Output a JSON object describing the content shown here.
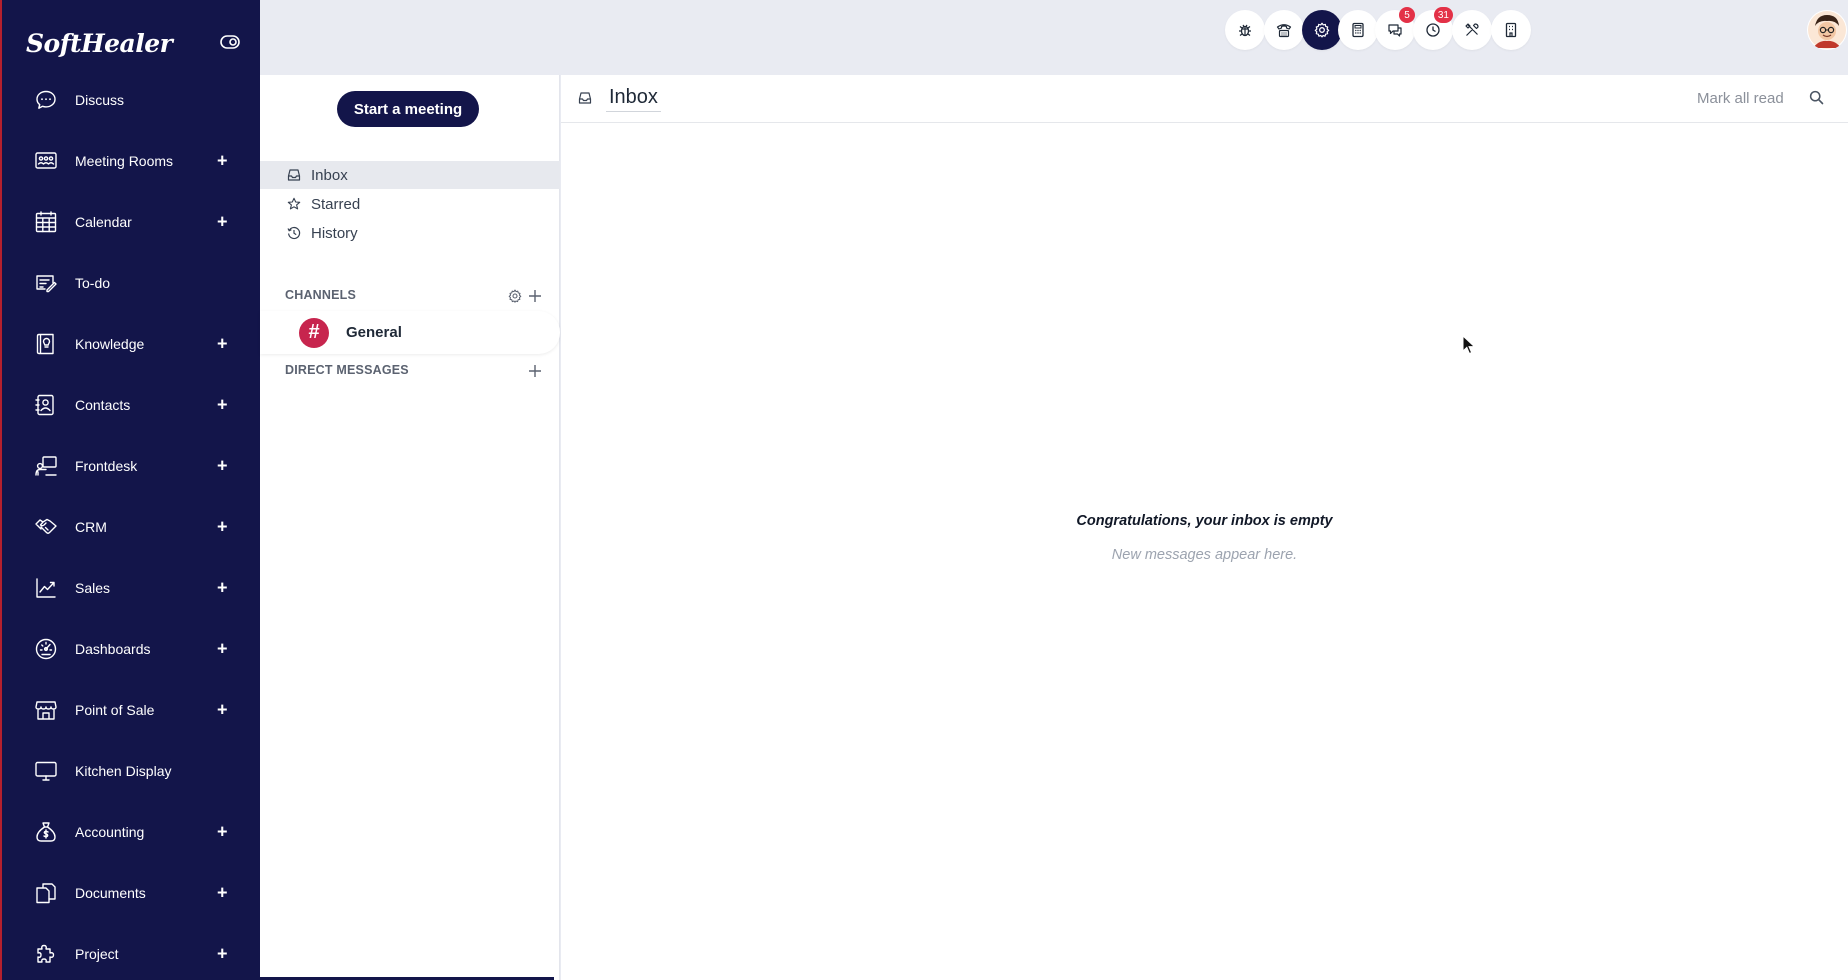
{
  "brand": {
    "name": "SoftHealer"
  },
  "colors": {
    "sidebar_bg": "#13154a",
    "accent_red": "#e33147",
    "channel_avatar": "#c7254e",
    "page_bg": "#e9ebf2"
  },
  "sidebar": {
    "items": [
      {
        "label": "Discuss",
        "icon": "chat-icon",
        "expandable": false
      },
      {
        "label": "Meeting Rooms",
        "icon": "meeting-room-icon",
        "expandable": true
      },
      {
        "label": "Calendar",
        "icon": "calendar-icon",
        "expandable": true
      },
      {
        "label": "To-do",
        "icon": "todo-icon",
        "expandable": false
      },
      {
        "label": "Knowledge",
        "icon": "knowledge-icon",
        "expandable": true
      },
      {
        "label": "Contacts",
        "icon": "contacts-icon",
        "expandable": true
      },
      {
        "label": "Frontdesk",
        "icon": "frontdesk-icon",
        "expandable": true
      },
      {
        "label": "CRM",
        "icon": "handshake-icon",
        "expandable": true
      },
      {
        "label": "Sales",
        "icon": "chart-line-icon",
        "expandable": true
      },
      {
        "label": "Dashboards",
        "icon": "gauge-icon",
        "expandable": true
      },
      {
        "label": "Point of Sale",
        "icon": "store-icon",
        "expandable": true
      },
      {
        "label": "Kitchen Display",
        "icon": "monitor-icon",
        "expandable": false
      },
      {
        "label": "Accounting",
        "icon": "money-bag-icon",
        "expandable": true
      },
      {
        "label": "Documents",
        "icon": "documents-icon",
        "expandable": true
      },
      {
        "label": "Project",
        "icon": "puzzle-icon",
        "expandable": true
      }
    ],
    "plus_symbol": "+"
  },
  "topbar": {
    "buttons": [
      {
        "icon": "bug-icon"
      },
      {
        "icon": "phone-icon"
      },
      {
        "icon": "gear-icon",
        "active": true
      },
      {
        "icon": "calculator-icon"
      },
      {
        "icon": "messages-icon",
        "badge": "5"
      },
      {
        "icon": "activity-clock-icon",
        "badge": "31"
      },
      {
        "icon": "tools-icon"
      },
      {
        "icon": "building-icon"
      }
    ],
    "avatar": "user-avatar"
  },
  "discuss": {
    "start_meeting": "Start a meeting",
    "mailboxes": [
      {
        "label": "Inbox",
        "icon": "inbox-icon",
        "active": true
      },
      {
        "label": "Starred",
        "icon": "star-icon",
        "active": false
      },
      {
        "label": "History",
        "icon": "history-icon",
        "active": false
      }
    ],
    "channels_header": "CHANNELS",
    "channels": [
      {
        "name": "General",
        "avatar": "#"
      }
    ],
    "dm_header": "DIRECT MESSAGES"
  },
  "thread": {
    "title": "Inbox",
    "mark_all_read": "Mark all read",
    "empty_title": "Congratulations, your inbox is empty",
    "empty_subtitle": "New messages appear here."
  }
}
